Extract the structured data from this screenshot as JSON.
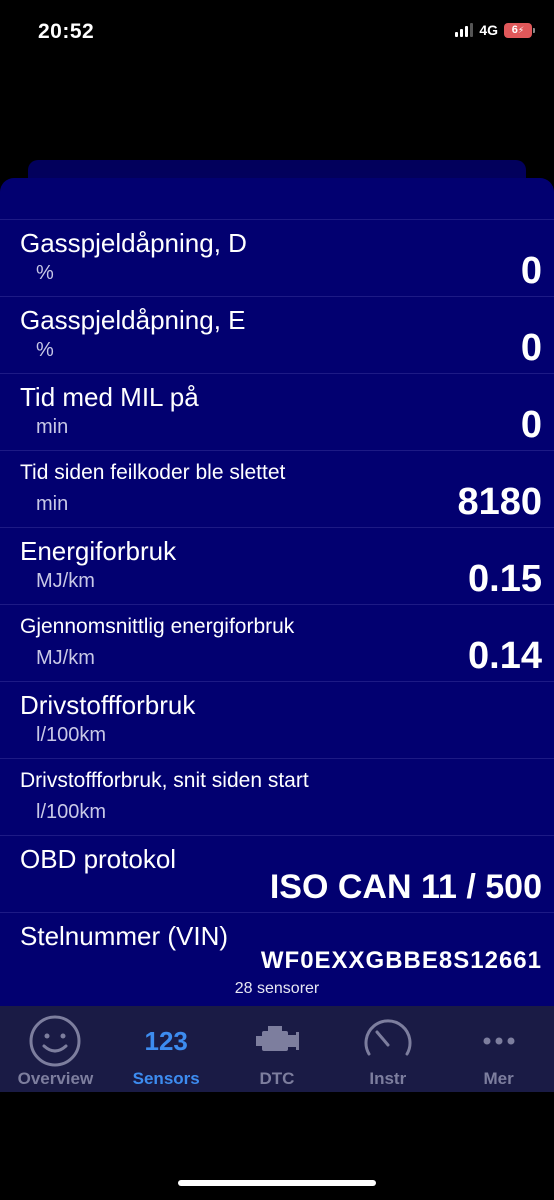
{
  "status": {
    "time": "20:52",
    "network": "4G",
    "battery": "6"
  },
  "sensors": [
    {
      "label": "Gasspjeldåpning, D",
      "unit": "%",
      "value": "0"
    },
    {
      "label": "Gasspjeldåpning, E",
      "unit": "%",
      "value": "0"
    },
    {
      "label": "Tid med MIL på",
      "unit": "min",
      "value": "0"
    },
    {
      "label": "Tid siden feilkoder ble slettet",
      "unit": "min",
      "value": "8180"
    },
    {
      "label": "Energiforbruk",
      "unit": "MJ/km",
      "value": "0.15"
    },
    {
      "label": "Gjennomsnittlig energiforbruk",
      "unit": "MJ/km",
      "value": "0.14"
    },
    {
      "label": "Drivstoffforbruk",
      "unit": "l/100km",
      "value": ""
    },
    {
      "label": "Drivstoffforbruk, snit siden start",
      "unit": "l/100km",
      "value": ""
    },
    {
      "label": "OBD protokol",
      "unit": "",
      "value": "ISO CAN 11 / 500"
    },
    {
      "label": "Stelnummer (VIN)",
      "unit": "",
      "value": "WF0EXXGBBE8S12661"
    }
  ],
  "sensor_count": "28 sensorer",
  "tabs": [
    {
      "label": "Overview",
      "icon": "smiley-face-icon"
    },
    {
      "label": "Sensors",
      "icon": "numbers-123-icon",
      "icon_text": "123"
    },
    {
      "label": "DTC",
      "icon": "engine-icon"
    },
    {
      "label": "Instr",
      "icon": "gauge-icon"
    },
    {
      "label": "Mer",
      "icon": "more-dots-icon"
    }
  ],
  "colors": {
    "panel": "#020070",
    "tabbar": "#1a1b45",
    "active": "#3d8cf0",
    "inactive": "#7d7e9e"
  }
}
